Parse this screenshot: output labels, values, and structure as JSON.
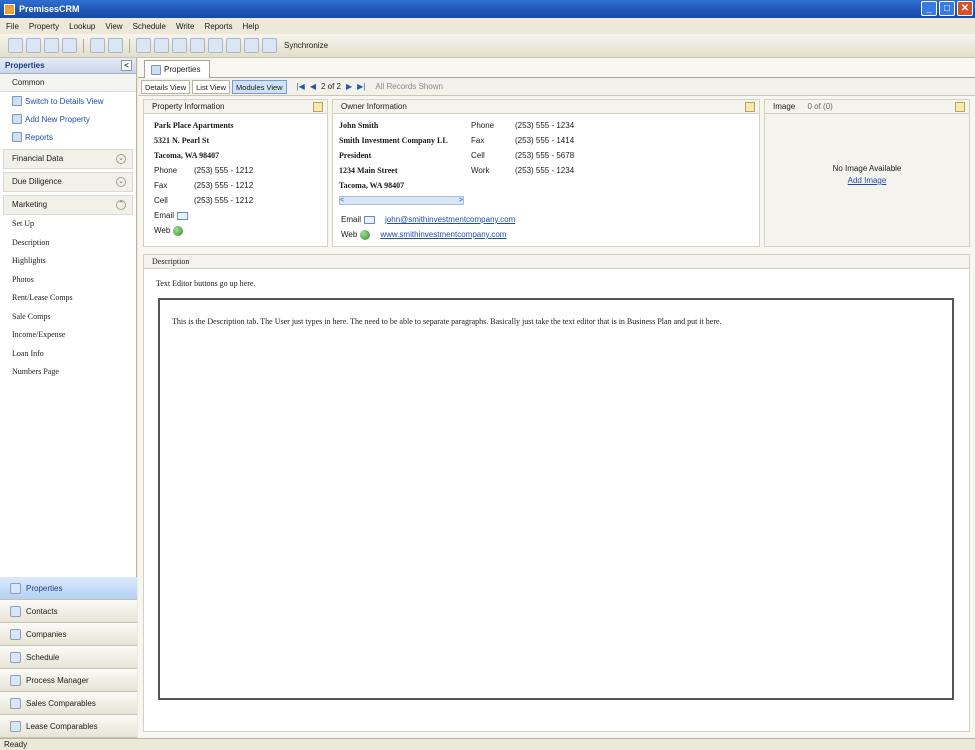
{
  "window": {
    "title": "PremisesCRM",
    "min": "_",
    "max": "□",
    "close": "✕"
  },
  "menu": [
    "File",
    "Property",
    "Lookup",
    "View",
    "Schedule",
    "Write",
    "Reports",
    "Help"
  ],
  "toolbar": {
    "sync_label": "Synchronize"
  },
  "left": {
    "header": "Properties",
    "collapse": "<",
    "common": "Common",
    "actions": [
      "Switch to Details View",
      "Add New Property",
      "Reports"
    ],
    "groups": [
      "Financial Data",
      "Due Diligence",
      "Marketing"
    ],
    "links": [
      "Set Up",
      "Description",
      "Highlights",
      "Photos",
      "Rent/Lease Comps",
      "Sale Comps",
      "Income/Expense",
      "Loan Info",
      "Numbers Page"
    ],
    "nav": [
      "Properties",
      "Contacts",
      "Companies",
      "Schedule",
      "Process Manager",
      "Sales Comparables",
      "Lease Comparables"
    ]
  },
  "status": "Ready",
  "main": {
    "tab": "Properties",
    "views": [
      "Details View",
      "List View",
      "Modules View"
    ],
    "pager": {
      "first": "|◀",
      "prev": "◀",
      "text": "2 of 2",
      "next": "▶",
      "last": "▶|"
    },
    "all_records": "All Records Shown"
  },
  "property": {
    "title": "Property Information",
    "name": "Park Place Apartments",
    "street": "5321 N. Pearl St",
    "city": "Tacoma, WA 98407",
    "phone_label": "Phone",
    "phone": "(253) 555 - 1212",
    "fax_label": "Fax",
    "fax": "(253) 555 - 1212",
    "cell_label": "Cell",
    "cell": "(253) 555 - 1212",
    "email_label": "Email",
    "web_label": "Web"
  },
  "owner": {
    "title": "Owner Information",
    "name": "John Smith",
    "company": "Smith Investment Company LL",
    "position": "President",
    "street": "1234 Main Street",
    "city": "Tacoma, WA 98407",
    "phone_label": "Phone",
    "phone": "(253) 555 - 1234",
    "fax_label": "Fax",
    "fax": "(253) 555 - 1414",
    "cell_label": "Cell",
    "cell": "(253) 555 - 5678",
    "work_label": "Work",
    "work": "(253) 555 - 1234",
    "scroll_left": "<",
    "scroll_right": ">",
    "email_label": "Email",
    "email": "john@smithinvestmentcompany.com",
    "web_label": "Web",
    "web": "www.smithinvestmentcompany.com"
  },
  "image": {
    "title": "Image",
    "nav_text": "0 of (0)",
    "none": "No Image Available",
    "add": "Add Image"
  },
  "description": {
    "title": "Description",
    "editor_note": "Text Editor buttons go up here.",
    "text": "This is the Description tab. The User just types in here. The need to be able to separate paragraphs. Basically just take the text editor that is in Business Plan and put it here."
  }
}
